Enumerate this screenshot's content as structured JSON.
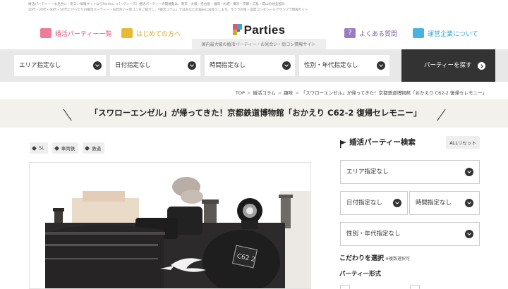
{
  "top_banner": {
    "line1": "婚活パーティー・お見合い・街コン情報サイトならParties（パーティーズ）婚活パーティーの開催数は、東京・大阪・名古屋・福岡・札幌・横浜・京都・広島・岡山の他全国の",
    "line2": "20代・30代・40代・50代にぴったりの婚活パーティー・お見合い・街コンをご紹介し、「婚活コラム」ではあなたの悩みにお答えします。サクラ対策・品質コンセシールでサンプラ情報サイト"
  },
  "header": {
    "nav": [
      {
        "label": "婚活パーティー一覧",
        "icon": "party-list-icon"
      },
      {
        "label": "はじめての方へ",
        "icon": "book-icon"
      },
      {
        "label": "よくある質問",
        "icon": "question-icon"
      },
      {
        "label": "運営企業について",
        "icon": "building-icon"
      }
    ],
    "logo_text": "Parties",
    "tagline": "国内最大級の婚活パーティー・お見合い・街コン情報サイト"
  },
  "searchbar": {
    "area": "エリア指定なし",
    "date": "日付指定なし",
    "time": "時間指定なし",
    "gender_age": "性別・年代指定なし",
    "submit": "パーティーを探す"
  },
  "breadcrumb": [
    "TOP",
    "婚活コラム",
    "趣味",
    "「スワローエンゼル」が帰ってきた！京都鉄道博物館「おかえり C62-2 復帰セレモニー」"
  ],
  "article": {
    "title": "「スワローエンゼル」が帰ってきた！京都鉄道博物館「おかえり C62-2 復帰セレモニー」",
    "tags": [
      "SL",
      "車両鉄",
      "鉄道"
    ],
    "photo_plate": "C62 2"
  },
  "sidebar": {
    "heading": "婚活パーティー検索",
    "reset": "ALLリセット",
    "area": "エリア指定なし",
    "date": "日付指定なし",
    "time": "時間指定なし",
    "gender_age": "性別・年代指定なし",
    "prefs_title": "こだわりを選択",
    "prefs_note": "※複数選択可",
    "party_type_title": "パーティー形式"
  },
  "colors": {
    "accent_pink": "#e0567a",
    "accent_yellow": "#d4a72c",
    "accent_purple": "#7b5fa8",
    "accent_blue": "#3da3cf",
    "dark": "#333333"
  }
}
